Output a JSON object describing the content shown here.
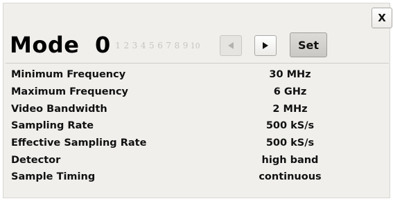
{
  "dialog": {
    "close_label": "X"
  },
  "header": {
    "title": "Mode",
    "current_mode": "0",
    "mode_options": [
      "1",
      "2",
      "3",
      "4",
      "5",
      "6",
      "7",
      "8",
      "9",
      "10"
    ],
    "prev_icon": "left-triangle-icon",
    "next_icon": "right-triangle-icon",
    "set_label": "Set"
  },
  "settings": [
    {
      "label": "Minimum Frequency",
      "value": "30 MHz"
    },
    {
      "label": "Maximum Frequency",
      "value": "6 GHz"
    },
    {
      "label": "Video Bandwidth",
      "value": "2 MHz"
    },
    {
      "label": "Sampling Rate",
      "value": "500 kS/s"
    },
    {
      "label": "Effective Sampling Rate",
      "value": "500 kS/s"
    },
    {
      "label": "Detector",
      "value": "high band"
    },
    {
      "label": "Sample Timing",
      "value": "continuous"
    }
  ],
  "colors": {
    "panel_bg": "#f0efec",
    "text": "#111111",
    "inactive_option": "#c6c5c2",
    "set_button_bg": "#c9c8c4"
  }
}
